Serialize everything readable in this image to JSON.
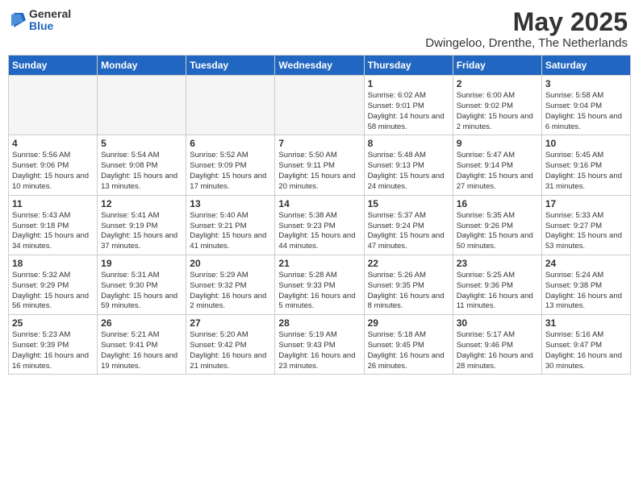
{
  "header": {
    "logo_general": "General",
    "logo_blue": "Blue",
    "month_title": "May 2025",
    "location": "Dwingeloo, Drenthe, The Netherlands"
  },
  "weekdays": [
    "Sunday",
    "Monday",
    "Tuesday",
    "Wednesday",
    "Thursday",
    "Friday",
    "Saturday"
  ],
  "weeks": [
    [
      {
        "day": "",
        "empty": true
      },
      {
        "day": "",
        "empty": true
      },
      {
        "day": "",
        "empty": true
      },
      {
        "day": "",
        "empty": true
      },
      {
        "day": "1",
        "sunrise": "6:02 AM",
        "sunset": "9:01 PM",
        "daylight": "14 hours and 58 minutes."
      },
      {
        "day": "2",
        "sunrise": "6:00 AM",
        "sunset": "9:02 PM",
        "daylight": "15 hours and 2 minutes."
      },
      {
        "day": "3",
        "sunrise": "5:58 AM",
        "sunset": "9:04 PM",
        "daylight": "15 hours and 6 minutes."
      }
    ],
    [
      {
        "day": "4",
        "sunrise": "5:56 AM",
        "sunset": "9:06 PM",
        "daylight": "15 hours and 10 minutes."
      },
      {
        "day": "5",
        "sunrise": "5:54 AM",
        "sunset": "9:08 PM",
        "daylight": "15 hours and 13 minutes."
      },
      {
        "day": "6",
        "sunrise": "5:52 AM",
        "sunset": "9:09 PM",
        "daylight": "15 hours and 17 minutes."
      },
      {
        "day": "7",
        "sunrise": "5:50 AM",
        "sunset": "9:11 PM",
        "daylight": "15 hours and 20 minutes."
      },
      {
        "day": "8",
        "sunrise": "5:48 AM",
        "sunset": "9:13 PM",
        "daylight": "15 hours and 24 minutes."
      },
      {
        "day": "9",
        "sunrise": "5:47 AM",
        "sunset": "9:14 PM",
        "daylight": "15 hours and 27 minutes."
      },
      {
        "day": "10",
        "sunrise": "5:45 AM",
        "sunset": "9:16 PM",
        "daylight": "15 hours and 31 minutes."
      }
    ],
    [
      {
        "day": "11",
        "sunrise": "5:43 AM",
        "sunset": "9:18 PM",
        "daylight": "15 hours and 34 minutes."
      },
      {
        "day": "12",
        "sunrise": "5:41 AM",
        "sunset": "9:19 PM",
        "daylight": "15 hours and 37 minutes."
      },
      {
        "day": "13",
        "sunrise": "5:40 AM",
        "sunset": "9:21 PM",
        "daylight": "15 hours and 41 minutes."
      },
      {
        "day": "14",
        "sunrise": "5:38 AM",
        "sunset": "9:23 PM",
        "daylight": "15 hours and 44 minutes."
      },
      {
        "day": "15",
        "sunrise": "5:37 AM",
        "sunset": "9:24 PM",
        "daylight": "15 hours and 47 minutes."
      },
      {
        "day": "16",
        "sunrise": "5:35 AM",
        "sunset": "9:26 PM",
        "daylight": "15 hours and 50 minutes."
      },
      {
        "day": "17",
        "sunrise": "5:33 AM",
        "sunset": "9:27 PM",
        "daylight": "15 hours and 53 minutes."
      }
    ],
    [
      {
        "day": "18",
        "sunrise": "5:32 AM",
        "sunset": "9:29 PM",
        "daylight": "15 hours and 56 minutes."
      },
      {
        "day": "19",
        "sunrise": "5:31 AM",
        "sunset": "9:30 PM",
        "daylight": "15 hours and 59 minutes."
      },
      {
        "day": "20",
        "sunrise": "5:29 AM",
        "sunset": "9:32 PM",
        "daylight": "16 hours and 2 minutes."
      },
      {
        "day": "21",
        "sunrise": "5:28 AM",
        "sunset": "9:33 PM",
        "daylight": "16 hours and 5 minutes."
      },
      {
        "day": "22",
        "sunrise": "5:26 AM",
        "sunset": "9:35 PM",
        "daylight": "16 hours and 8 minutes."
      },
      {
        "day": "23",
        "sunrise": "5:25 AM",
        "sunset": "9:36 PM",
        "daylight": "16 hours and 11 minutes."
      },
      {
        "day": "24",
        "sunrise": "5:24 AM",
        "sunset": "9:38 PM",
        "daylight": "16 hours and 13 minutes."
      }
    ],
    [
      {
        "day": "25",
        "sunrise": "5:23 AM",
        "sunset": "9:39 PM",
        "daylight": "16 hours and 16 minutes."
      },
      {
        "day": "26",
        "sunrise": "5:21 AM",
        "sunset": "9:41 PM",
        "daylight": "16 hours and 19 minutes."
      },
      {
        "day": "27",
        "sunrise": "5:20 AM",
        "sunset": "9:42 PM",
        "daylight": "16 hours and 21 minutes."
      },
      {
        "day": "28",
        "sunrise": "5:19 AM",
        "sunset": "9:43 PM",
        "daylight": "16 hours and 23 minutes."
      },
      {
        "day": "29",
        "sunrise": "5:18 AM",
        "sunset": "9:45 PM",
        "daylight": "16 hours and 26 minutes."
      },
      {
        "day": "30",
        "sunrise": "5:17 AM",
        "sunset": "9:46 PM",
        "daylight": "16 hours and 28 minutes."
      },
      {
        "day": "31",
        "sunrise": "5:16 AM",
        "sunset": "9:47 PM",
        "daylight": "16 hours and 30 minutes."
      }
    ]
  ],
  "labels": {
    "sunrise_label": "Sunrise:",
    "sunset_label": "Sunset:",
    "daylight_label": "Daylight:"
  }
}
